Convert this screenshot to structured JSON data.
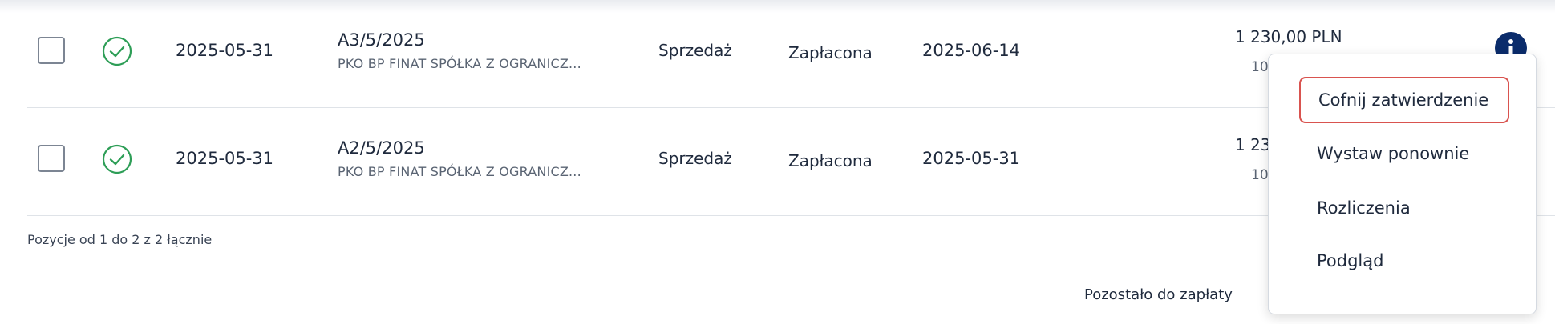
{
  "rows": [
    {
      "date": "2025-05-31",
      "number": "A3/5/2025",
      "client": "PKO BP FINAT SPÓŁKA Z OGRANICZ...",
      "type": "Sprzedaż",
      "status": "Zapłacona",
      "due_date": "2025-06-14",
      "amount": "1 230,00 PLN",
      "amount_sub": "10"
    },
    {
      "date": "2025-05-31",
      "number": "A2/5/2025",
      "client": "PKO BP FINAT SPÓŁKA Z OGRANICZ...",
      "type": "Sprzedaż",
      "status": "Zapłacona",
      "due_date": "2025-05-31",
      "amount": "1 23",
      "amount_sub": "10"
    }
  ],
  "footer": {
    "count_text": "Pozycje od 1 do 2 z 2 łącznie",
    "remaining_label": "Pozostało do zapłaty"
  },
  "context_menu": {
    "items": [
      {
        "label": "Cofnij zatwierdzenie",
        "active": true
      },
      {
        "label": "Wystaw ponownie",
        "active": false
      },
      {
        "label": "Rozliczenia",
        "active": false
      },
      {
        "label": "Podgląd",
        "active": false
      }
    ]
  },
  "icons": {
    "status": "check-circle-icon",
    "info": "info-icon"
  },
  "colors": {
    "status_green": "#2e9e57",
    "info_navy": "#0b2c6b",
    "active_border": "#d9534f"
  }
}
